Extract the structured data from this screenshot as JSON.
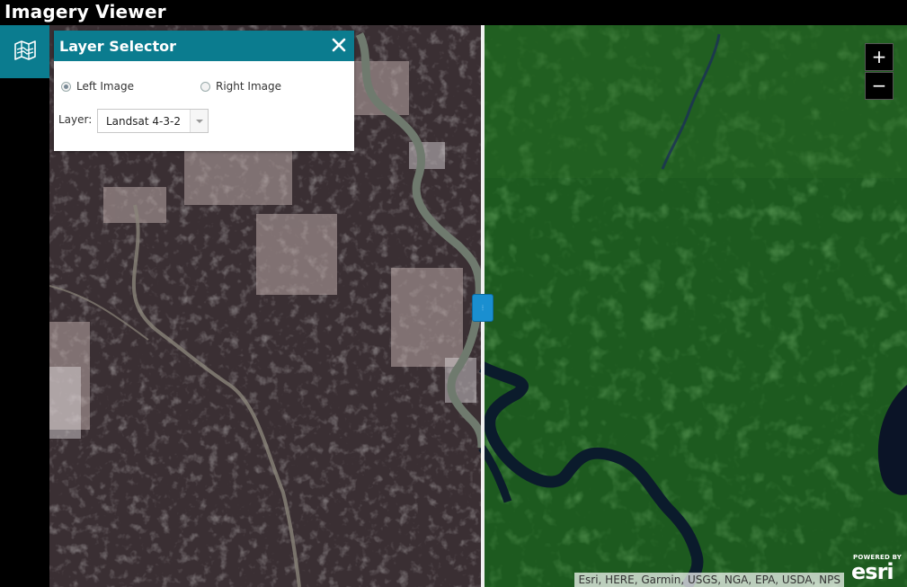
{
  "app": {
    "title": "Imagery Viewer"
  },
  "toolbar": {
    "layer_tool_icon": "map-layers-icon"
  },
  "layer_selector": {
    "title": "Layer Selector",
    "close_icon": "close-icon",
    "options": [
      {
        "label": "Left Image",
        "checked": true
      },
      {
        "label": "Right Image",
        "checked": false
      }
    ],
    "layer_label": "Layer:",
    "layer_value": "Landsat 4-3-2"
  },
  "zoom": {
    "in_label": "+",
    "out_label": "−"
  },
  "swipe": {
    "handle_icon": "grip-icon",
    "handle_glyph": "⦙"
  },
  "attribution": {
    "text": "Esri, HERE, Garmin, USGS, NGA, EPA, USDA, NPS"
  },
  "logo": {
    "powered_text": "POWERED BY",
    "brand_text": "esri"
  },
  "colors": {
    "accent": "#0b7c8f",
    "handle": "#1a8fd0"
  }
}
